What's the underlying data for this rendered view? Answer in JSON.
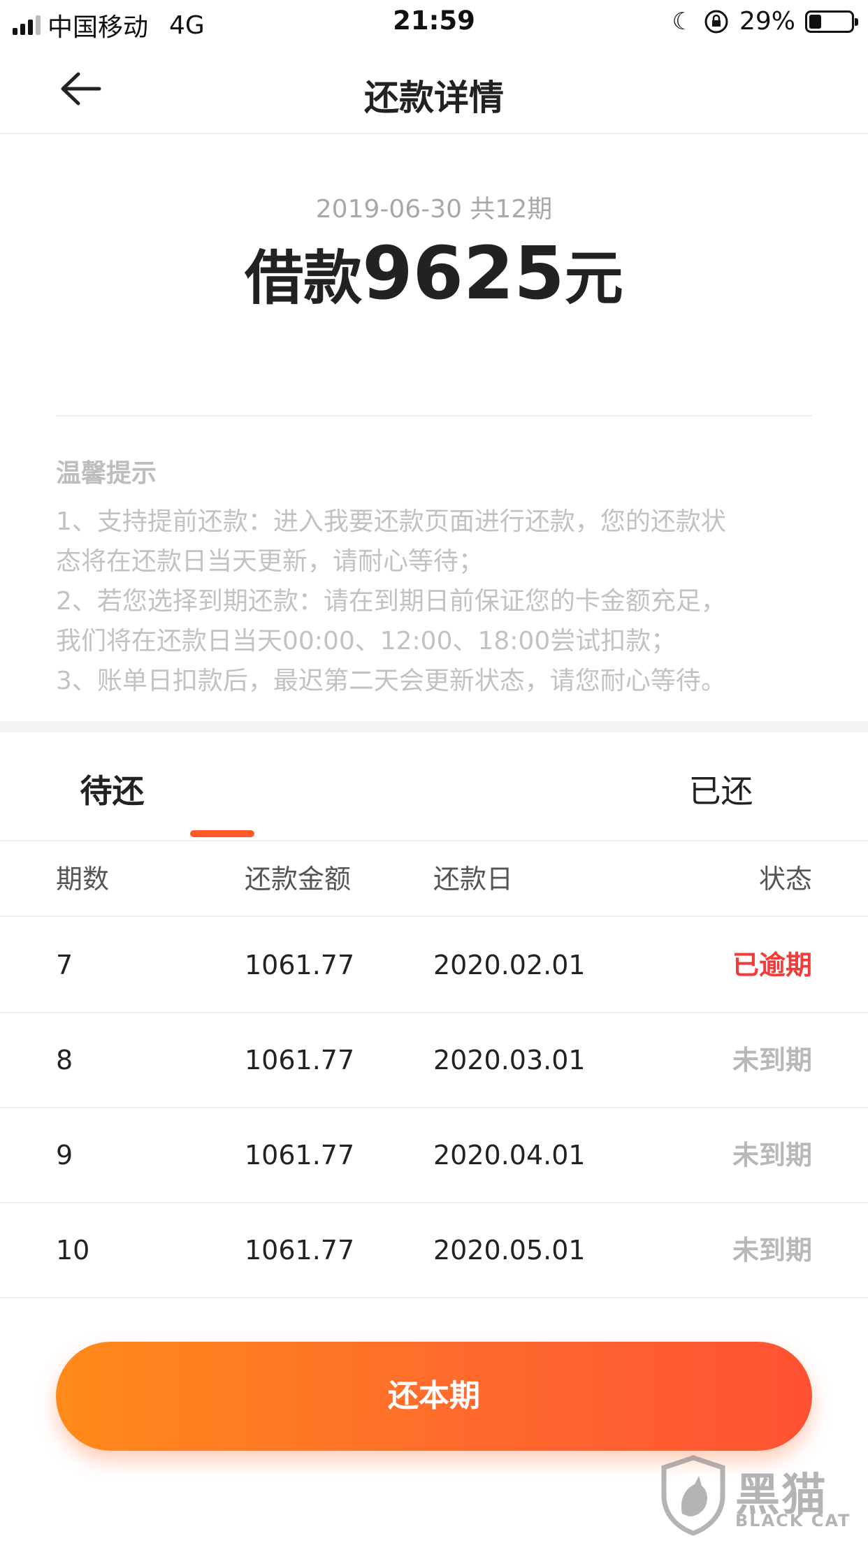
{
  "status_bar": {
    "carrier": "中国移动",
    "network": "4G",
    "time": "21:59",
    "battery_percent": "29%",
    "battery_level": 0.29
  },
  "nav": {
    "title": "还款详情",
    "back_icon": "arrow-left-icon"
  },
  "loan": {
    "subtitle": "2019-06-30 共12期",
    "amount_prefix": "借款",
    "amount": "9625",
    "amount_suffix": "元"
  },
  "tips": {
    "title": "温馨提示",
    "lines": [
      "1、支持提前还款：进入我要还款页面进行还款，您的还款状",
      "态将在还款日当天更新，请耐心等待；",
      "2、若您选择到期还款：请在到期日前保证您的卡金额充足，",
      "我们将在还款日当天00:00、12:00、18:00尝试扣款；",
      "3、账单日扣款后，最迟第二天会更新状态，请您耐心等待。"
    ]
  },
  "tabs": [
    {
      "label": "待还",
      "active": true
    },
    {
      "label": "已还",
      "active": false
    }
  ],
  "table": {
    "headers": [
      "期数",
      "还款金额",
      "还款日",
      "状态"
    ],
    "rows": [
      {
        "period": "7",
        "amount": "1061.77",
        "date": "2020.02.01",
        "status": "已逾期"
      },
      {
        "period": "8",
        "amount": "1061.77",
        "date": "2020.03.01",
        "status": "未到期"
      },
      {
        "period": "9",
        "amount": "1061.77",
        "date": "2020.04.01",
        "status": "未到期"
      },
      {
        "period": "10",
        "amount": "1061.77",
        "date": "2020.05.01",
        "status": "未到期"
      }
    ]
  },
  "pay_button": {
    "label": "还本期"
  },
  "watermark": {
    "cn": "黑猫",
    "en": "BLACK CAT"
  },
  "colors": {
    "accent": "#ff5a2a",
    "overdue": "#f23b3b",
    "pending": "#b8b8b8",
    "button_gradient_start": "#ff8a1a",
    "button_gradient_end": "#ff5233"
  }
}
